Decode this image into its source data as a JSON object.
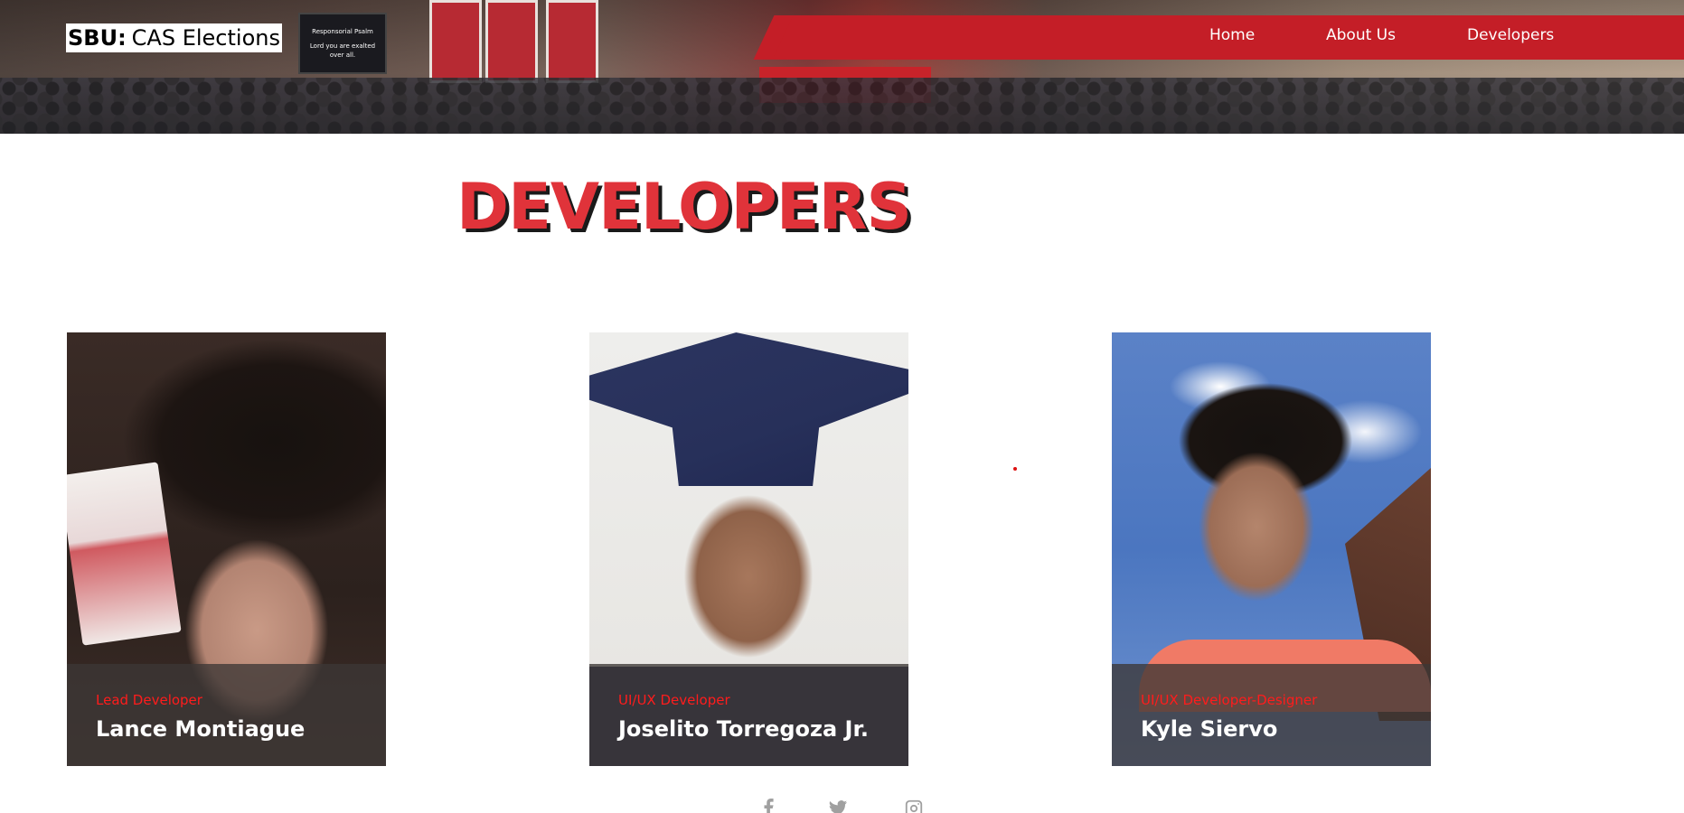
{
  "brand": {
    "prefix": "SBU:",
    "name": "CAS Elections"
  },
  "hero": {
    "screen_title": "Responsorial Psalm",
    "screen_text": "Lord you are exalted over all."
  },
  "nav": {
    "items": [
      {
        "label": "Home"
      },
      {
        "label": "About Us"
      },
      {
        "label": "Developers"
      }
    ]
  },
  "page": {
    "title": "DEVELOPERS"
  },
  "developers": [
    {
      "role": "Lead Developer",
      "name": "Lance Montiague"
    },
    {
      "role": "UI/UX Developer",
      "name": "Joselito Torregoza Jr."
    },
    {
      "role": "UI/UX Developer-Designer",
      "name": "Kyle Siervo"
    }
  ],
  "social": [
    {
      "icon": "facebook-icon"
    },
    {
      "icon": "twitter-icon"
    },
    {
      "icon": "instagram-icon"
    }
  ],
  "colors": {
    "accent": "#c41e27",
    "title": "#e0333a",
    "role": "#ff1c1c"
  }
}
